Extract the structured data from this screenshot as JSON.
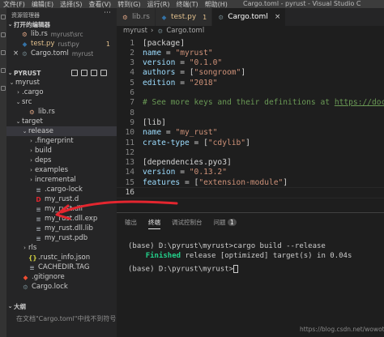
{
  "menubar": {
    "items": [
      "文件(F)",
      "编辑(E)",
      "选择(S)",
      "查看(V)",
      "转到(G)",
      "运行(R)",
      "终端(T)",
      "帮助(H)"
    ],
    "window_title": "Cargo.toml - pyrust - Visual Studio C"
  },
  "sidebar": {
    "title": "资源管理器",
    "open_editors_label": "打开的编辑器",
    "open_editors": [
      {
        "name": "lib.rs",
        "desc": "myrust\\src",
        "icon": "rust-icon",
        "close": false
      },
      {
        "name": "test.py",
        "desc": "rust\\py",
        "icon": "python-icon",
        "num": "1",
        "modified": true
      },
      {
        "name": "Cargo.toml",
        "desc": "myrust",
        "icon": "gear-icon",
        "close": true
      }
    ],
    "project_label": "PYRUST",
    "tree": [
      {
        "label": "myrust",
        "chev": "⌄"
      },
      {
        "label": ".cargo",
        "chev": "›"
      },
      {
        "label": "src",
        "chev": "⌄"
      },
      {
        "label": "lib.rs",
        "icon": "rust-icon"
      },
      {
        "label": "target",
        "chev": "⌄"
      },
      {
        "label": "release",
        "chev": "⌄",
        "selected": true
      },
      {
        "label": ".fingerprint",
        "chev": "›"
      },
      {
        "label": "build",
        "chev": "›"
      },
      {
        "label": "deps",
        "chev": "›"
      },
      {
        "label": "examples",
        "chev": "›"
      },
      {
        "label": "incremental",
        "chev": "›"
      },
      {
        "label": ".cargo-lock",
        "icon": "file-lines-icon"
      },
      {
        "label": "my_rust.d",
        "icon": "d-file-icon"
      },
      {
        "label": "my_rust.dll",
        "icon": "file-lines-icon"
      },
      {
        "label": "my_rust.dll.exp",
        "icon": "file-lines-icon"
      },
      {
        "label": "my_rust.dll.lib",
        "icon": "file-lines-icon"
      },
      {
        "label": "my_rust.pdb",
        "icon": "file-lines-icon"
      },
      {
        "label": "rls",
        "chev": "›"
      },
      {
        "label": ".rustc_info.json",
        "icon": "braces-icon"
      },
      {
        "label": "CACHEDIR.TAG",
        "icon": "file-lines-icon"
      },
      {
        "label": ".gitignore",
        "icon": "diamond-icon"
      },
      {
        "label": "Cargo.lock",
        "icon": "gear-icon"
      }
    ],
    "outline_label": "大纲",
    "outline_empty": "在文档\"Cargo.toml\"中找不到符号"
  },
  "tabs": [
    {
      "label": "lib.rs",
      "icon": "rust-icon",
      "active": false
    },
    {
      "label": "test.py",
      "icon": "python-icon",
      "num": "1",
      "active": false
    },
    {
      "label": "Cargo.toml",
      "icon": "gear-icon",
      "active": true,
      "close": "×"
    }
  ],
  "breadcrumb": [
    "myrust",
    "Cargo.toml"
  ],
  "editor": {
    "lines": [
      {
        "n": "1",
        "segs": [
          [
            "p",
            "[package]"
          ]
        ]
      },
      {
        "n": "2",
        "segs": [
          [
            "k",
            "name"
          ],
          [
            "p",
            " = "
          ],
          [
            "s",
            "\"myrust\""
          ]
        ]
      },
      {
        "n": "3",
        "segs": [
          [
            "k",
            "version"
          ],
          [
            "p",
            " = "
          ],
          [
            "s",
            "\"0.1.0\""
          ]
        ]
      },
      {
        "n": "4",
        "segs": [
          [
            "k",
            "authors"
          ],
          [
            "p",
            " = ["
          ],
          [
            "s",
            "\"songroom\""
          ],
          [
            "p",
            "]"
          ]
        ]
      },
      {
        "n": "5",
        "segs": [
          [
            "k",
            "edition"
          ],
          [
            "p",
            " = "
          ],
          [
            "s",
            "\"2018\""
          ]
        ]
      },
      {
        "n": "6",
        "segs": []
      },
      {
        "n": "7",
        "segs": [
          [
            "c",
            "# See more keys and their definitions at "
          ],
          [
            "u",
            "https://doc.rust"
          ]
        ]
      },
      {
        "n": "8",
        "segs": []
      },
      {
        "n": "9",
        "segs": [
          [
            "p",
            "[lib]"
          ]
        ]
      },
      {
        "n": "10",
        "segs": [
          [
            "k",
            "name"
          ],
          [
            "p",
            " = "
          ],
          [
            "s",
            "\"my_rust\""
          ]
        ]
      },
      {
        "n": "11",
        "segs": [
          [
            "k",
            "crate-type"
          ],
          [
            "p",
            " = ["
          ],
          [
            "s",
            "\"cdylib\""
          ],
          [
            "p",
            "]"
          ]
        ]
      },
      {
        "n": "12",
        "segs": []
      },
      {
        "n": "13",
        "segs": [
          [
            "p",
            "[dependencies.pyo3]"
          ]
        ]
      },
      {
        "n": "14",
        "segs": [
          [
            "k",
            "version"
          ],
          [
            "p",
            " = "
          ],
          [
            "s",
            "\"0.13.2\""
          ]
        ]
      },
      {
        "n": "15",
        "segs": [
          [
            "k",
            "features"
          ],
          [
            "p",
            " = ["
          ],
          [
            "s",
            "\"extension-module\""
          ],
          [
            "p",
            "]"
          ]
        ]
      },
      {
        "n": "16",
        "segs": [],
        "current": true
      }
    ]
  },
  "panel": {
    "tabs": [
      "输出",
      "终端",
      "调试控制台",
      "问题"
    ],
    "active_tab": "终端",
    "problems_count": "1",
    "terminal": [
      "(base) D:\\pyrust\\myrust>cargo build --release",
      {
        "green": "Finished",
        "rest": " release [optimized] target(s) in 0.04s"
      },
      "(base) D:\\pyrust\\myrust>"
    ]
  },
  "watermark": "https://blog.csdn.net/wowotuo",
  "annotation": {
    "color": "#e3262f",
    "points_to": "my_rust.dll"
  }
}
